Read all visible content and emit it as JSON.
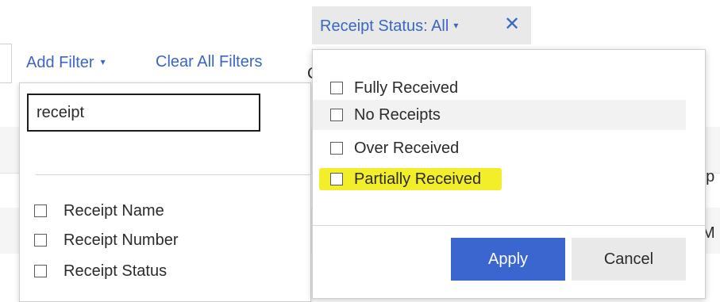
{
  "toolbar": {
    "add_filter_label": "Add Filter",
    "clear_all_label": "Clear All Filters",
    "caret": "▾"
  },
  "background_fragments": {
    "c_fragment": "C",
    "op_fragment": "op",
    "m_fragment": "M"
  },
  "status_chip": {
    "label": "Receipt Status: All",
    "caret": "▾",
    "close_glyph": "✕"
  },
  "filter_panel": {
    "search_value": "receipt",
    "options": [
      "Receipt Name",
      "Receipt Number",
      "Receipt Status"
    ]
  },
  "status_panel": {
    "options": [
      "Fully Received",
      "No Receipts",
      "Over Received",
      "Partially Received"
    ],
    "apply_label": "Apply",
    "cancel_label": "Cancel"
  },
  "colors": {
    "link_blue": "#3b66c4",
    "apply_blue": "#3b66d0",
    "highlight_yellow": "#f2ef2a"
  }
}
